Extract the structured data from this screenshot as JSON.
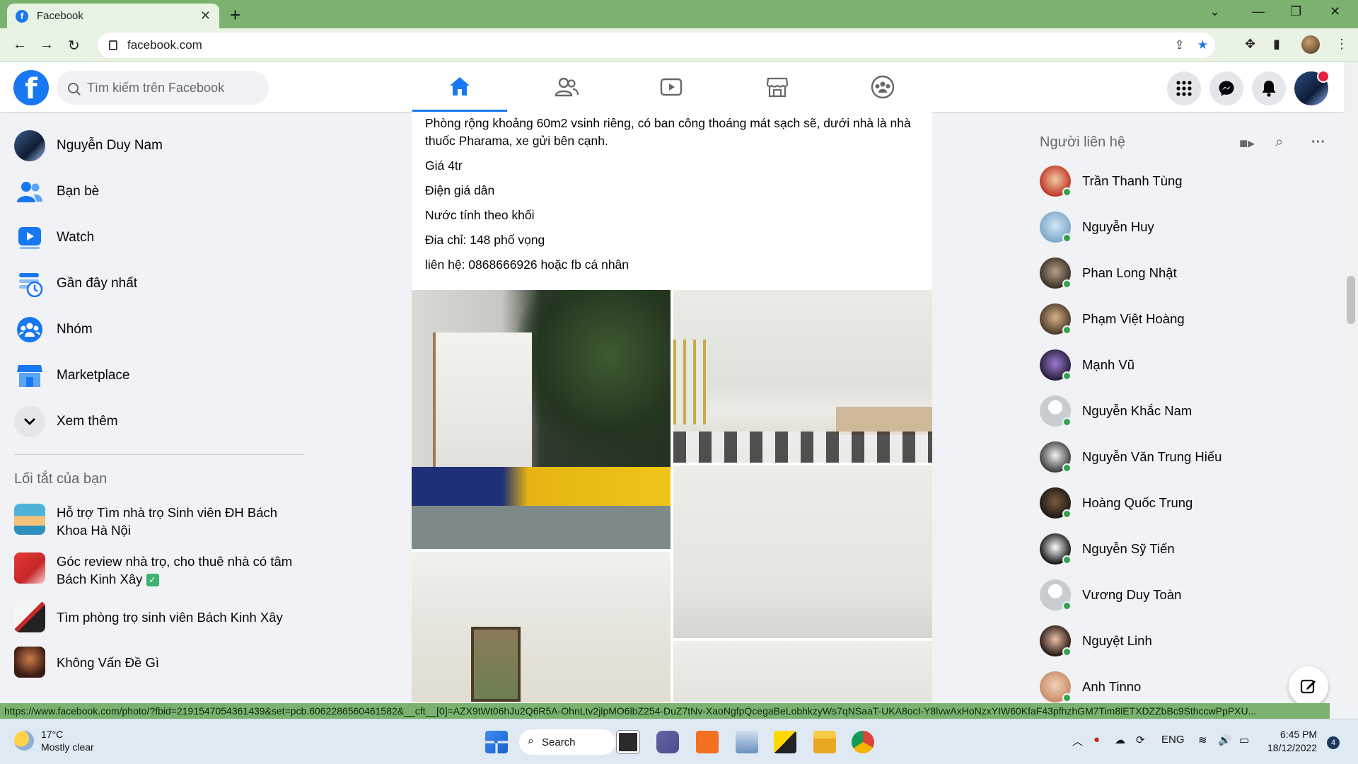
{
  "browser": {
    "tab_title": "Facebook",
    "tab_favicon": "f",
    "url": "facebook.com",
    "theme_color": "#7cb26f"
  },
  "fb": {
    "logo": "f",
    "search_placeholder": "Tìm kiếm trên Facebook",
    "brand_color": "#1877f2"
  },
  "left_nav": [
    {
      "label": "Nguyễn Duy Nam",
      "icon": "profile-avatar"
    },
    {
      "label": "Bạn bè",
      "icon": "friends-icon"
    },
    {
      "label": "Watch",
      "icon": "watch-icon"
    },
    {
      "label": "Gần đây nhất",
      "icon": "recent-icon"
    },
    {
      "label": "Nhóm",
      "icon": "groups-icon"
    },
    {
      "label": "Marketplace",
      "icon": "marketplace-icon"
    },
    {
      "label": "Xem thêm",
      "icon": "chevron-down-icon"
    }
  ],
  "shortcuts": {
    "heading": "Lối tắt của bạn",
    "items": [
      {
        "label": "Hỗ trợ Tìm nhà trọ Sinh viên ĐH Bách Khoa Hà Nội"
      },
      {
        "label": "Góc review nhà trọ, cho thuê nhà có tâm Bách Kinh Xây"
      },
      {
        "label": "Tìm phòng trọ sinh viên Bách Kinh Xây"
      },
      {
        "label": "Không Vấn Đề Gì"
      }
    ]
  },
  "post": {
    "lines": [
      "Phòng rộng khoảng 60m2 vsinh riêng, có ban công thoáng mát sạch sẽ, dưới nhà là nhà thuốc Pharama, xe gửi bên cạnh.",
      "Giá 4tr",
      "Điện giá dân",
      "Nước tính theo khối",
      "Đia chỉ: 148 phố vọng",
      "liên hệ: 0868666926 hoặc fb cá nhân"
    ]
  },
  "contacts": {
    "heading": "Người liên hệ",
    "items": [
      {
        "name": "Trần Thanh Tùng"
      },
      {
        "name": "Nguyễn Huy"
      },
      {
        "name": "Phan Long Nhật"
      },
      {
        "name": "Phạm Việt Hoàng"
      },
      {
        "name": "Mạnh Vũ"
      },
      {
        "name": "Nguyễn Khắc Nam"
      },
      {
        "name": "Nguyễn Văn Trung Hiếu"
      },
      {
        "name": "Hoàng Quốc Trung"
      },
      {
        "name": "Nguyễn Sỹ Tiến"
      },
      {
        "name": "Vương Duy Toàn"
      },
      {
        "name": "Nguyệt Linh"
      },
      {
        "name": "Anh Tinno"
      }
    ]
  },
  "status_url": "https://www.facebook.com/photo/?fbid=2191547054361439&set=pcb.6062286560461582&__cft__[0]=AZX9tWt06hJu2Q6R5A-OhnLtv2jlpMO6lbZ254-DuZ7tNv-XaoNgfpQcegaBeLobhkzyWs7qNSaaT-UKA8ocI-Y8lvwAxHoNzxYIW60KfaF43pfhzhGM7Tim8lETXDZZbBc9SthccwPpPXU...",
  "taskbar": {
    "temperature": "17°C",
    "weather": "Mostly clear",
    "search_label": "Search",
    "language": "ENG",
    "time": "6:45 PM",
    "date": "18/12/2022",
    "notification_count": "4"
  }
}
